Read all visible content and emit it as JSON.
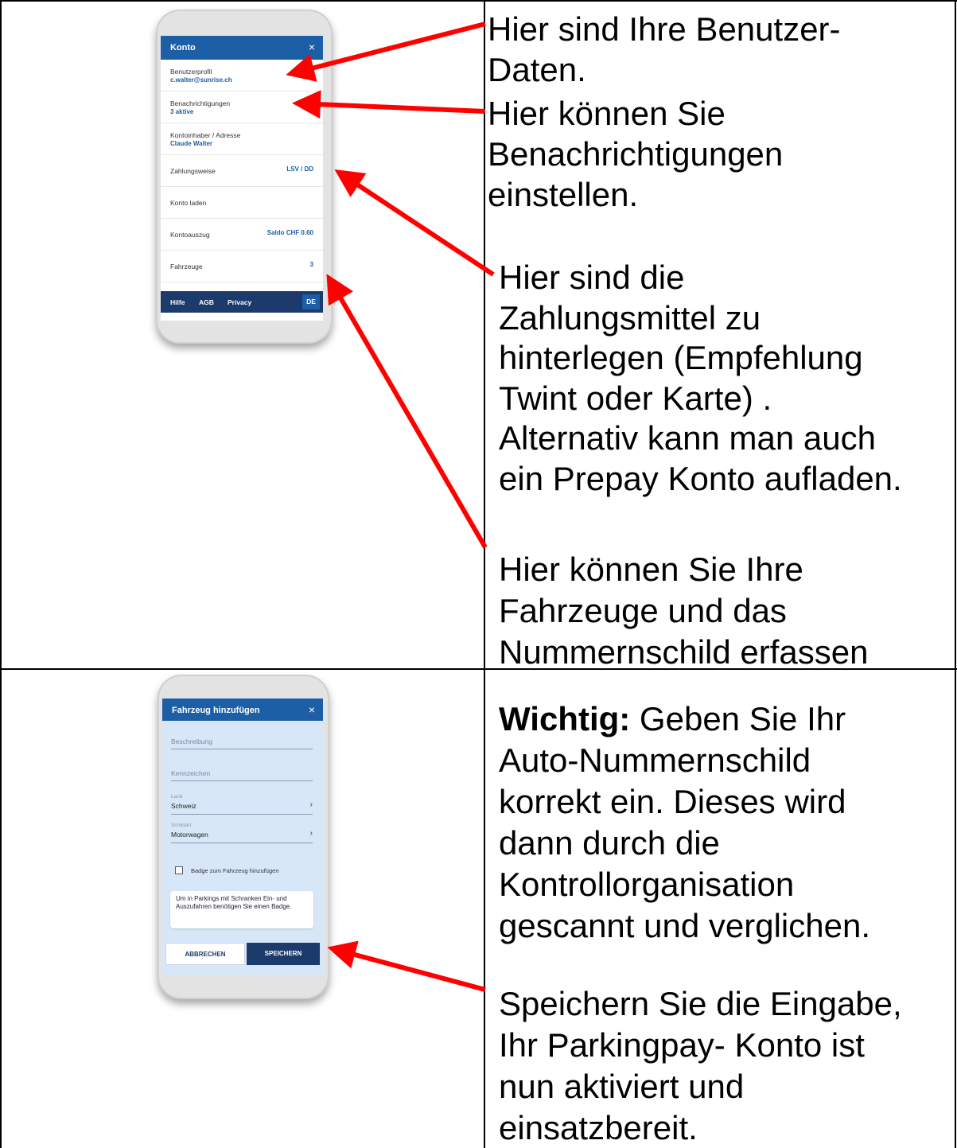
{
  "section1": {
    "screen": {
      "title": "Konto",
      "close": "×",
      "rows": [
        {
          "label": "Benutzerprofil",
          "sub": "c.walter@sunrise.ch",
          "value": ""
        },
        {
          "label": "Benachrichtigungen",
          "sub": "3 aktive",
          "value": ""
        },
        {
          "label": "Kontoinhaber / Adresse",
          "sub": "Claude Walter",
          "value": ""
        },
        {
          "label": "Zahlungsweise",
          "sub": "",
          "value": "LSV / DD"
        },
        {
          "label": "Konto laden",
          "sub": "",
          "value": ""
        },
        {
          "label": "Kontoauszug",
          "sub": "",
          "value": "Saldo CHF 0.60"
        },
        {
          "label": "Fahrzeuge",
          "sub": "",
          "value": "3"
        }
      ],
      "footer": {
        "help": "Hilfe",
        "agb": "AGB",
        "privacy": "Privacy",
        "lang": "DE"
      }
    },
    "notes": {
      "user_data": "Hier sind Ihre Benutzer-\nDaten.",
      "notifications": "Hier können Sie\nBenachrichtigungen\neinstellen.",
      "payment": "Hier sind die\nZahlungsmittel zu\nhinterlegen (Empfehlung\nTwint oder Karte) .\nAlternativ kann man auch\nein Prepay Konto aufladen.",
      "vehicles": "Hier können Sie Ihre\nFahrzeuge und das\nNummernschild erfassen"
    }
  },
  "section2": {
    "screen": {
      "title": "Fahrzeug hinzufügen",
      "close": "×",
      "description_placeholder": "Beschreibung",
      "plate_placeholder": "Kennzeichen",
      "country_label": "Land",
      "country_value": "Schweiz",
      "plate_type_label": "Schildart",
      "plate_type_value": "Motorwagen",
      "chevron": "›",
      "badge_checkbox_label": "Badge zum Fahrzeug hinzufügen",
      "info_note": "Um in Parkings mit Schranken Ein- und Auszufahren benötigen Sie einen Badge.",
      "cancel_button": "ABBRECHEN",
      "save_button": "SPEICHERN"
    },
    "notes": {
      "important_bold": "Wichtig:",
      "important_text": " Geben Sie Ihr\nAuto-Nummernschild\nkorrekt ein. Dieses wird\ndann durch die\nKontrollorganisation\ngescannt und verglichen.",
      "save": "Speichern Sie die Eingabe,\nIhr Parkingpay- Konto ist\nnun aktiviert und\neinsatzbereit."
    }
  },
  "colors": {
    "arrow": "#ff0000",
    "brand_blue": "#1c5fa6",
    "navy": "#1c3a6b",
    "form_bg": "#d7e7f8"
  }
}
